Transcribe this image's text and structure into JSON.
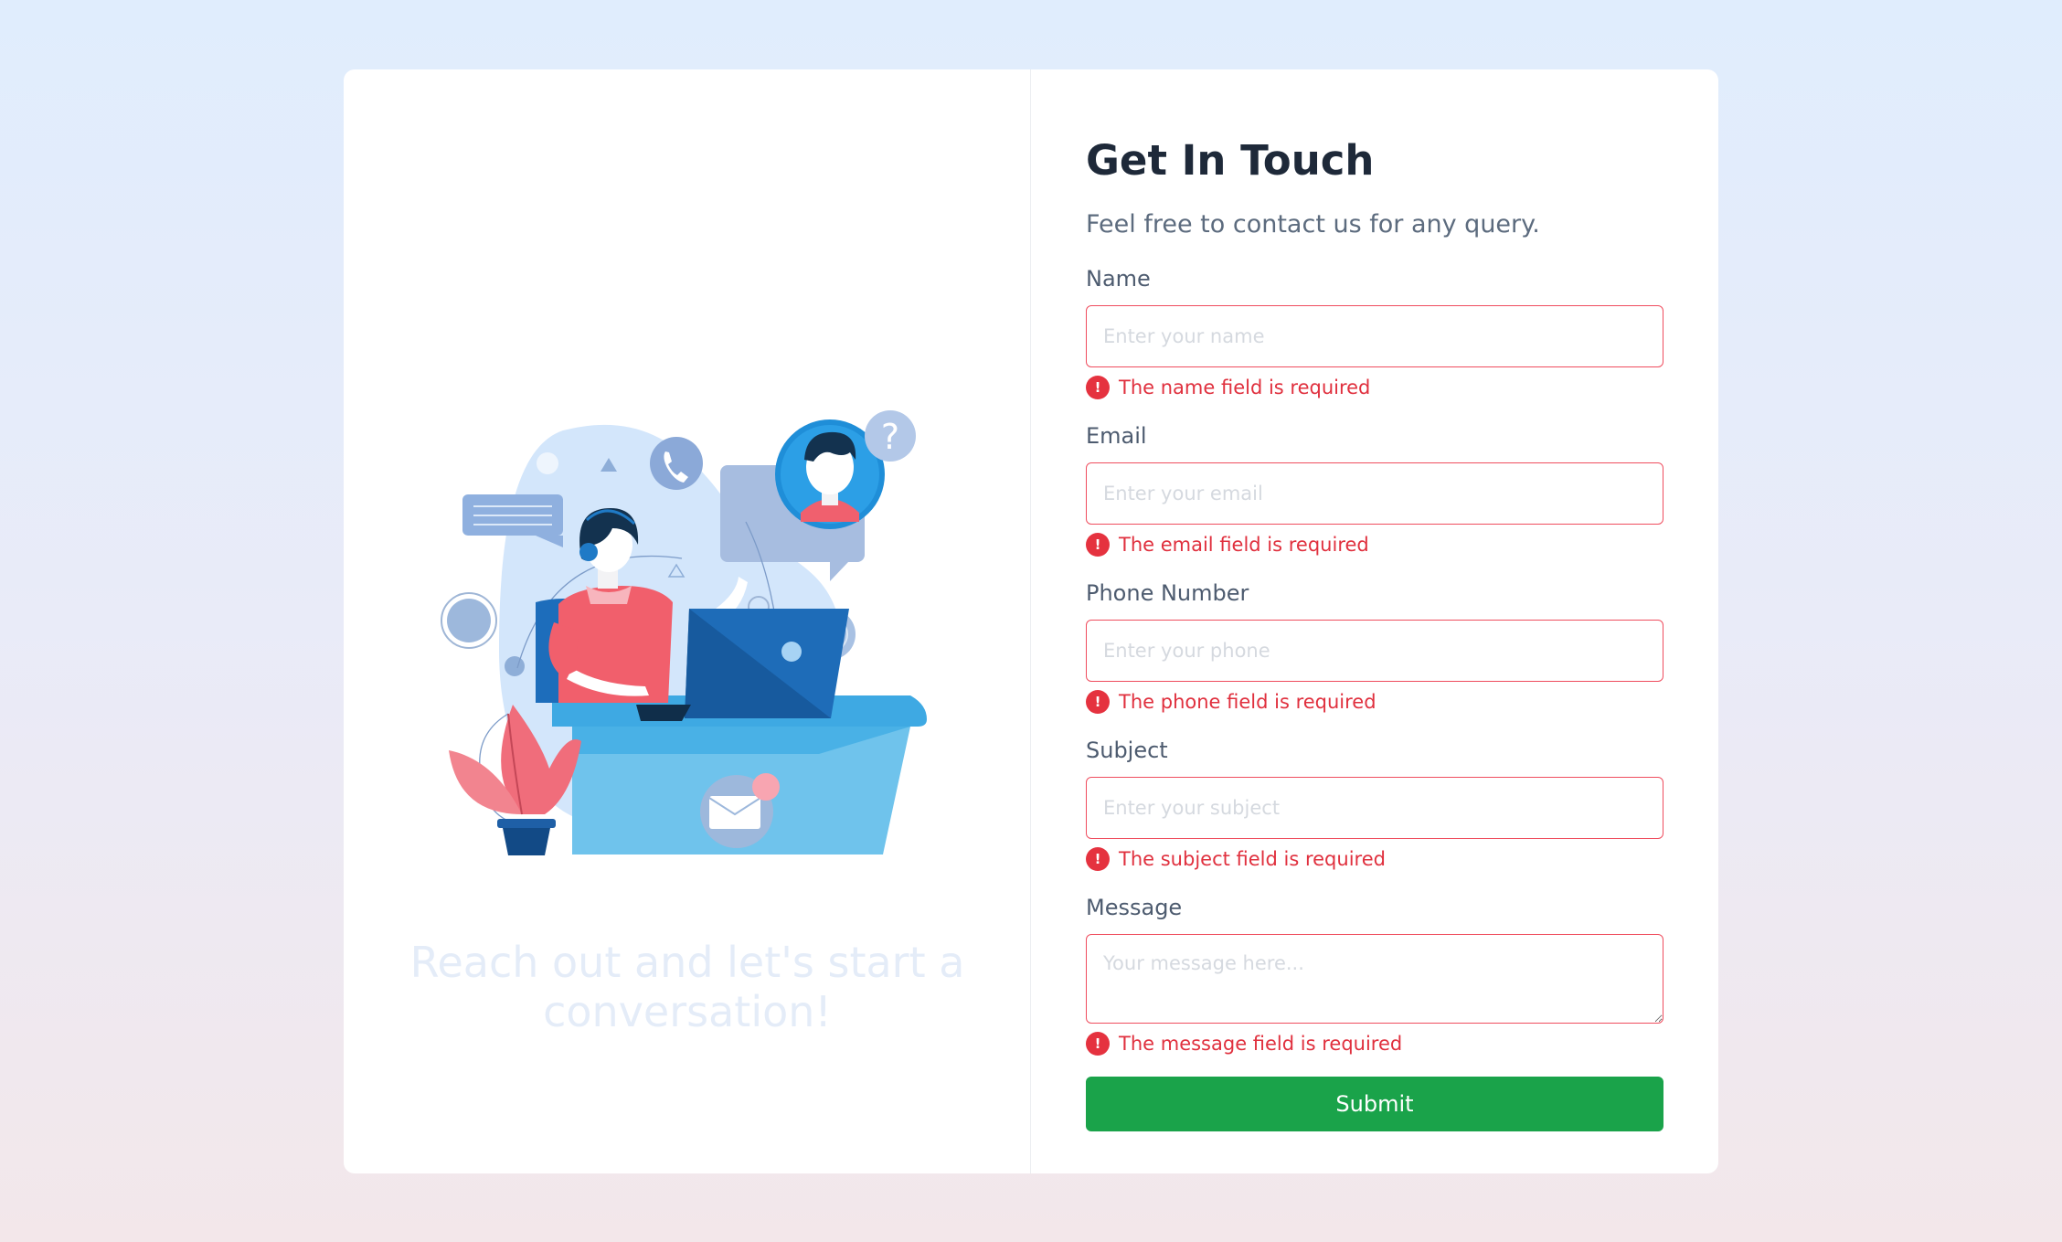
{
  "left": {
    "tagline": "Reach out and let's start a conversation!"
  },
  "form": {
    "title": "Get In Touch",
    "subtitle": "Feel free to contact us for any query.",
    "fields": {
      "name": {
        "label": "Name",
        "placeholder": "Enter your name",
        "value": "",
        "error": "The name field is required"
      },
      "email": {
        "label": "Email",
        "placeholder": "Enter your email",
        "value": "",
        "error": "The email field is required"
      },
      "phone": {
        "label": "Phone Number",
        "placeholder": "Enter your phone",
        "value": "",
        "error": "The phone field is required"
      },
      "subject": {
        "label": "Subject",
        "placeholder": "Enter your subject",
        "value": "",
        "error": "The subject field is required"
      },
      "message": {
        "label": "Message",
        "placeholder": "Your message here...",
        "value": "",
        "error": "The message field is required"
      }
    },
    "error_icon": "!",
    "submit_label": "Submit"
  },
  "colors": {
    "accent_green": "#1aa34a",
    "error_red": "#e5323f",
    "title": "#1e2939"
  },
  "icons": [
    "phone-icon",
    "question-icon",
    "mail-icon",
    "chat-bubble-icon",
    "laptop-icon",
    "plant-icon",
    "error-icon"
  ]
}
